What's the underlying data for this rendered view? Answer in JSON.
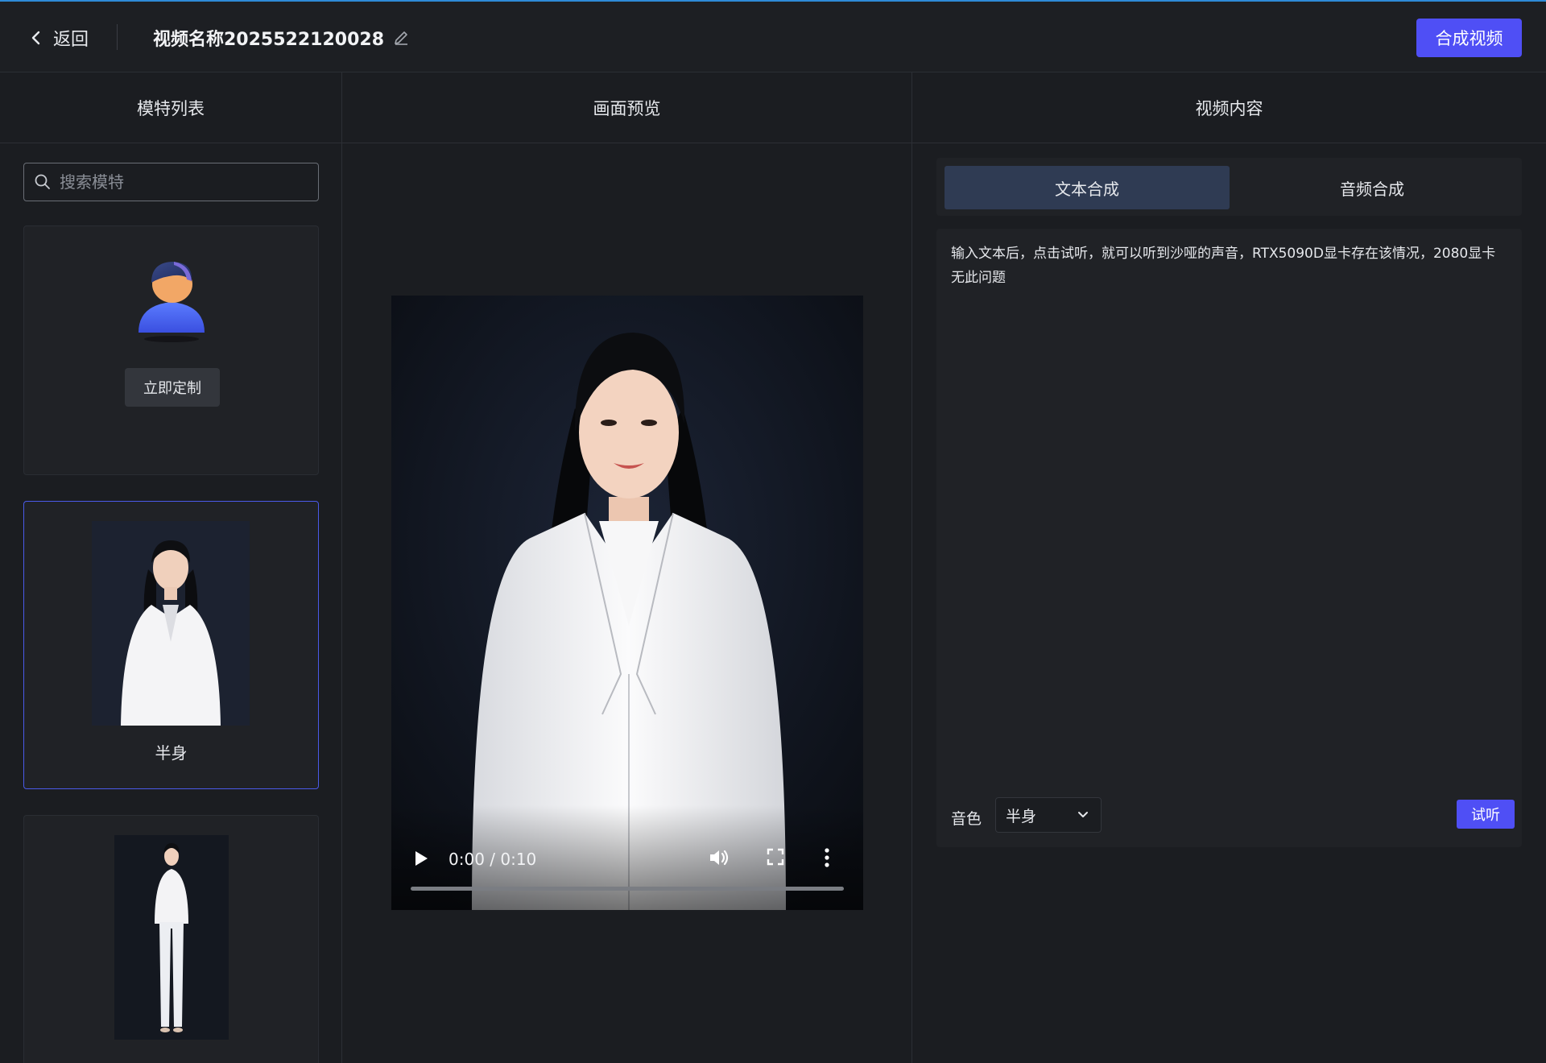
{
  "header": {
    "back_label": "返回",
    "video_title": "视频名称2025522120028",
    "compose_label": "合成视频"
  },
  "columns": {
    "models_title": "模特列表",
    "preview_title": "画面预览",
    "content_title": "视频内容"
  },
  "search": {
    "placeholder": "搜索模特"
  },
  "models": {
    "customize_label": "立即定制",
    "items": [
      {
        "label": "半身",
        "selected": true
      },
      {
        "label": "",
        "selected": false
      }
    ]
  },
  "player": {
    "time": "0:00 / 0:10"
  },
  "content": {
    "tabs": [
      {
        "label": "文本合成",
        "active": true
      },
      {
        "label": "音频合成",
        "active": false
      }
    ],
    "text": "输入文本后，点击试听，就可以听到沙哑的声音，RTX5090D显卡存在该情况，2080显卡无此问题",
    "voice_label": "音色",
    "voice_value": "半身",
    "listen_label": "试听"
  },
  "colors": {
    "accent": "#4f4ff5",
    "active_tab": "#2f3b53",
    "background": "#1b1d21"
  }
}
